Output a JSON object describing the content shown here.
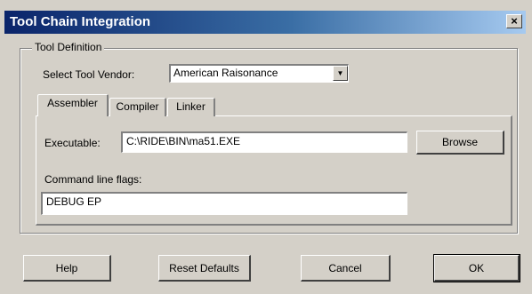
{
  "window": {
    "title": "Tool Chain Integration",
    "close_label": "×"
  },
  "tool_definition": {
    "group_label": "Tool Definition",
    "vendor_label": "Select Tool Vendor:",
    "vendor_value": "American Raisonance",
    "vendor_arrow": "▼"
  },
  "tabs": [
    {
      "label": "Assembler",
      "active": true
    },
    {
      "label": "Compiler",
      "active": false
    },
    {
      "label": "Linker",
      "active": false
    }
  ],
  "assembler": {
    "executable_label": "Executable:",
    "executable_value": "C:\\RIDE\\BIN\\ma51.EXE",
    "browse_label": "Browse",
    "flags_label": "Command line flags:",
    "flags_value": "DEBUG EP"
  },
  "footer": {
    "help_label": "Help",
    "reset_label": "Reset Defaults",
    "cancel_label": "Cancel",
    "ok_label": "OK"
  }
}
